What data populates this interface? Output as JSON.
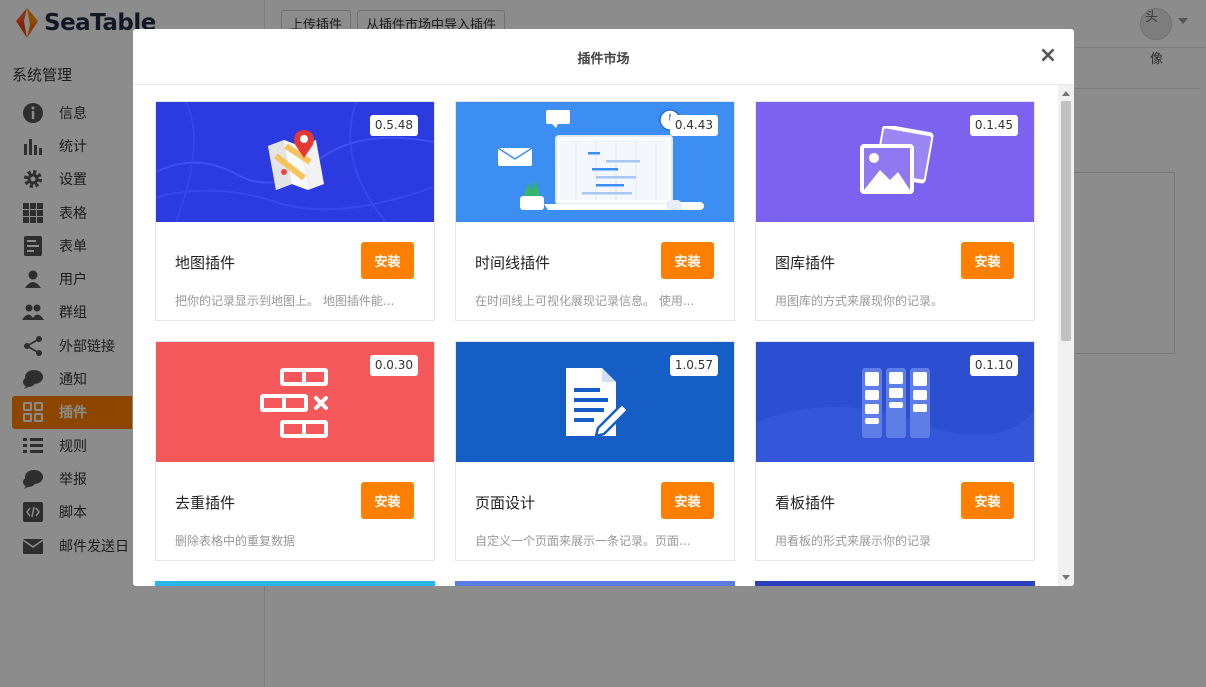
{
  "app": {
    "brand": "SeaTable",
    "sidebar_title": "系统管理",
    "nav": [
      {
        "label": "信息",
        "icon": "info-icon",
        "active": false
      },
      {
        "label": "统计",
        "icon": "bar-chart-icon",
        "active": false
      },
      {
        "label": "设置",
        "icon": "gear-icon",
        "active": false
      },
      {
        "label": "表格",
        "icon": "grid-icon",
        "active": false
      },
      {
        "label": "表单",
        "icon": "form-icon",
        "active": false
      },
      {
        "label": "用户",
        "icon": "user-icon",
        "active": false
      },
      {
        "label": "群组",
        "icon": "group-icon",
        "active": false
      },
      {
        "label": "外部链接",
        "icon": "share-icon",
        "active": false
      },
      {
        "label": "通知",
        "icon": "chat-bubble-icon",
        "active": false
      },
      {
        "label": "插件",
        "icon": "plugin-icon",
        "active": true
      },
      {
        "label": "规则",
        "icon": "rules-icon",
        "active": false
      },
      {
        "label": "举报",
        "icon": "report-icon",
        "active": false
      },
      {
        "label": "脚本",
        "icon": "code-icon",
        "active": false
      },
      {
        "label": "邮件发送日",
        "icon": "mail-icon",
        "active": false
      }
    ],
    "top_buttons": [
      "上传插件",
      "从插件市场中导入插件"
    ],
    "avatar_alt": "头像",
    "avatar_alt_1": "头",
    "avatar_alt_2": "像"
  },
  "modal": {
    "title": "插件市场",
    "close": "×",
    "install_label": "安装",
    "plugins": [
      {
        "name": "地图插件",
        "version": "0.5.48",
        "desc": "把你的记录显示到地图上。 地图插件能...",
        "banner": "#2b3be0"
      },
      {
        "name": "时间线插件",
        "version": "0.4.43",
        "desc": "在时间线上可视化展现记录信息。 使用...",
        "banner": "#3d8ef2"
      },
      {
        "name": "图库插件",
        "version": "0.1.45",
        "desc": "用图库的方式来展现你的记录。",
        "banner": "#7b63ef"
      },
      {
        "name": "去重插件",
        "version": "0.0.30",
        "desc": "删除表格中的重复数据",
        "banner": "#f5585a"
      },
      {
        "name": "页面设计",
        "version": "1.0.57",
        "desc": "自定义一个页面来展示一条记录。页面...",
        "banner": "#155ec6"
      },
      {
        "name": "看板插件",
        "version": "0.1.10",
        "desc": "用看板的形式来展示你的记录",
        "banner": "#2c4fd1"
      }
    ],
    "peek_colors": [
      "#28b5f0",
      "#5b7be6",
      "#2c3fbf"
    ]
  }
}
